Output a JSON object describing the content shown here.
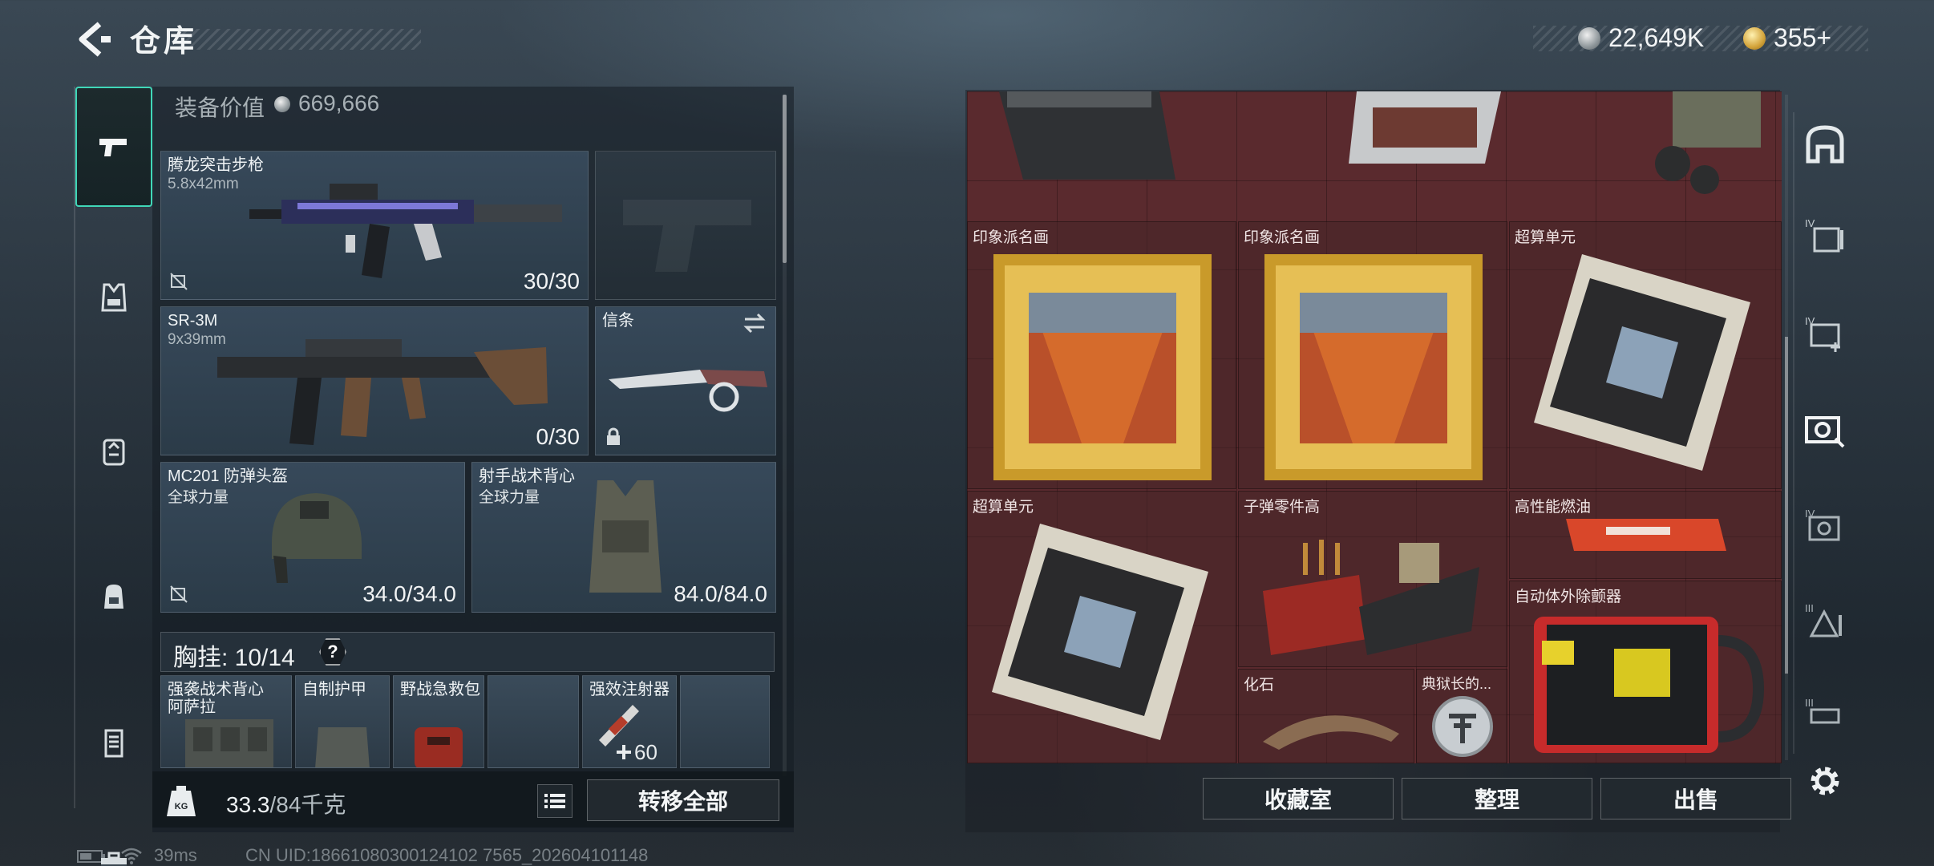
{
  "header": {
    "title": "仓库",
    "currency_silver": "22,649K",
    "currency_gold": "355+"
  },
  "left_rail": {
    "tabs": [
      {
        "name": "pistol-icon",
        "active": true
      },
      {
        "name": "vest-icon",
        "active": false
      },
      {
        "name": "backpack-alt-icon",
        "active": false
      },
      {
        "name": "backpack-icon",
        "active": false
      },
      {
        "name": "case-icon",
        "active": false
      },
      {
        "name": "toolbox-icon",
        "active": false
      }
    ]
  },
  "loadout": {
    "equip_value_label": "装备价值",
    "equip_value": "669,666",
    "primary": {
      "name": "腾龙突击步枪",
      "caliber": "5.8x42mm",
      "ammo": "30/30"
    },
    "secondary": {
      "name": "SR-3M",
      "caliber": "9x39mm",
      "ammo": "0/30"
    },
    "melee": {
      "name": "信条"
    },
    "helmet": {
      "name": "MC201 防弹头盔",
      "faction": "全球力量",
      "durability": "34.0/34.0"
    },
    "armor": {
      "name": "射手战术背心",
      "faction": "全球力量",
      "durability": "84.0/84.0"
    },
    "chest_rig": {
      "label": "胸挂: 10/14",
      "help": "?",
      "items": [
        {
          "name": "强袭战术背心",
          "sub": "阿萨拉"
        },
        {
          "name": "自制护甲",
          "sub": ""
        },
        {
          "name": "野战急救包",
          "sub": ""
        },
        {
          "name": "",
          "sub": ""
        },
        {
          "name": "强效注射器",
          "sub": "",
          "count": "60"
        },
        {
          "name": "",
          "sub": ""
        }
      ]
    },
    "weight": "33.3",
    "weight_max": "/84千克",
    "transfer_all": "转移全部"
  },
  "status": {
    "ping": "39ms",
    "uid": "CN UID:18661080300124102 7565_202604101148"
  },
  "stash": {
    "cells": [
      {
        "label": "印象派名画"
      },
      {
        "label": "印象派名画"
      },
      {
        "label": "超算单元"
      },
      {
        "label": "超算单元"
      },
      {
        "label": "子弹零件高"
      },
      {
        "label": "高性能燃油"
      },
      {
        "label": "自动体外除颤器"
      },
      {
        "label": "化石"
      },
      {
        "label": "典狱长的..."
      }
    ],
    "buttons": {
      "collection": "收藏室",
      "sort": "整理",
      "sell": "出售"
    }
  },
  "right_rail": {
    "items": [
      "vault-icon",
      "storage-iv-icon",
      "storage-iv-plus-icon",
      "storage-camera-icon",
      "storage-iv-b-icon",
      "storage-iii-icon",
      "storage-iii-b-icon"
    ]
  },
  "colors": {
    "accent": "#40d7b8",
    "stash_bg": "#5a2a2e",
    "slot_bg": "#37495a"
  }
}
